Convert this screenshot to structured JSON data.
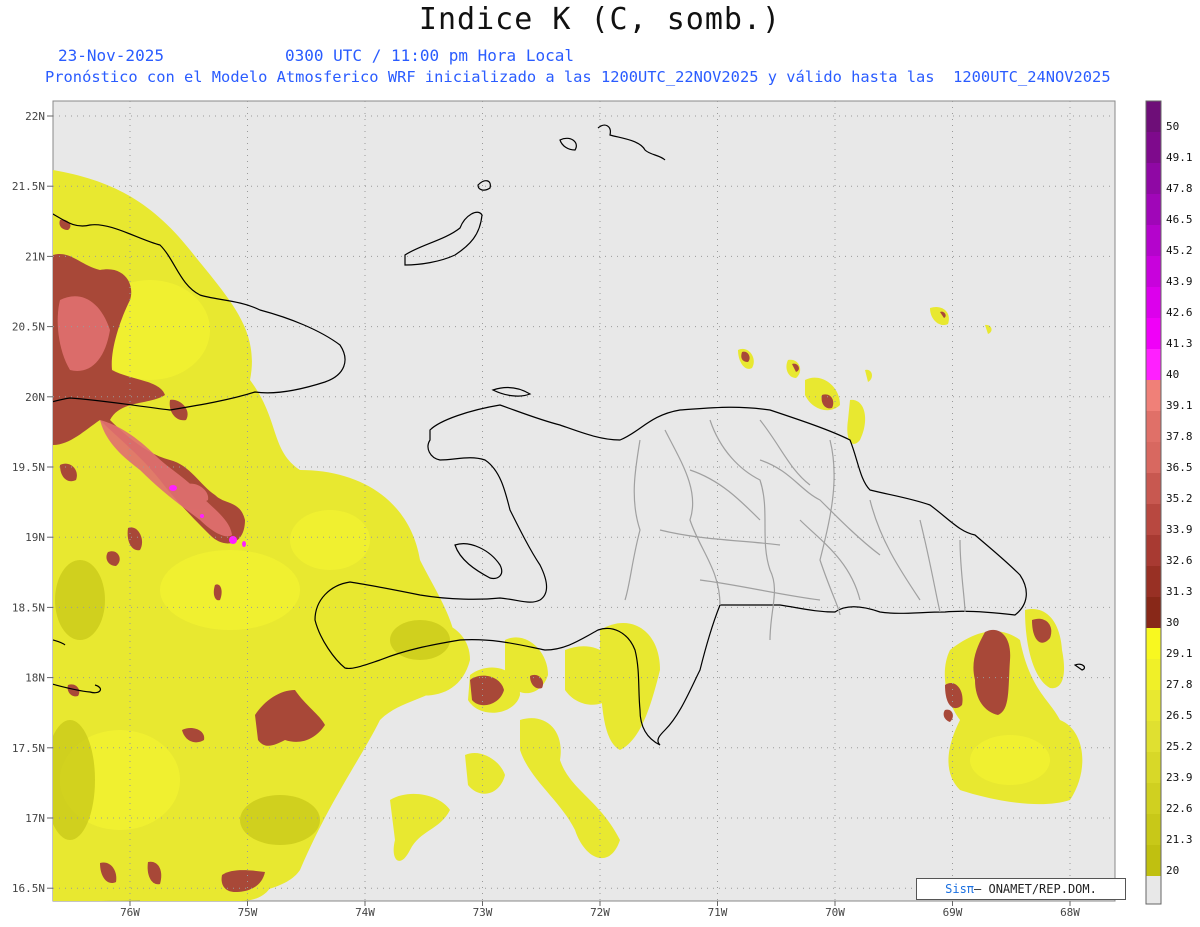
{
  "header": {
    "title": "Indice K (C, somb.)",
    "date": "23-Nov-2025",
    "time": "0300 UTC / 11:00 pm Hora Local",
    "description": "Pronóstico con el Modelo Atmosferico WRF inicializado a las 1200UTC_22NOV2025 y válido hasta las  1200UTC_24NOV2025"
  },
  "map": {
    "background_color": "#e8e8e8",
    "lat_labels": [
      "22N",
      "21.5N",
      "21N",
      "20.5N",
      "20N",
      "19.5N",
      "19N",
      "18.5N",
      "18N",
      "17.5N",
      "17N",
      "16.5N"
    ],
    "lon_labels": [
      "76W",
      "75W",
      "74W",
      "73W",
      "72W",
      "71W",
      "70W",
      "69W",
      "68W"
    ]
  },
  "colorbar": {
    "labels": [
      "50",
      "49.1",
      "47.8",
      "46.5",
      "45.2",
      "43.9",
      "42.6",
      "41.3",
      "40",
      "39.1",
      "37.8",
      "36.5",
      "35.2",
      "33.9",
      "32.6",
      "31.3",
      "30",
      "29.1",
      "27.8",
      "26.5",
      "25.2",
      "23.9",
      "22.6",
      "21.3",
      "20"
    ],
    "colors": [
      "#6e0e78",
      "#7e0a8c",
      "#8f08a4",
      "#a006b8",
      "#b404cc",
      "#c802dc",
      "#dc00ec",
      "#f000f8",
      "#ff20ff",
      "#f08078",
      "#e07068",
      "#d86860",
      "#c85850",
      "#b84840",
      "#a83a32",
      "#983024",
      "#882818",
      "#f8f820",
      "#f0f028",
      "#e8e830",
      "#e0e030",
      "#d8d828",
      "#d0d020",
      "#c8c818",
      "#c0c010"
    ],
    "bottom_empty_color": "#e8e8e8"
  },
  "credit": {
    "brand": "Sisπ",
    "text": "– ONAMET/REP.DOM."
  }
}
